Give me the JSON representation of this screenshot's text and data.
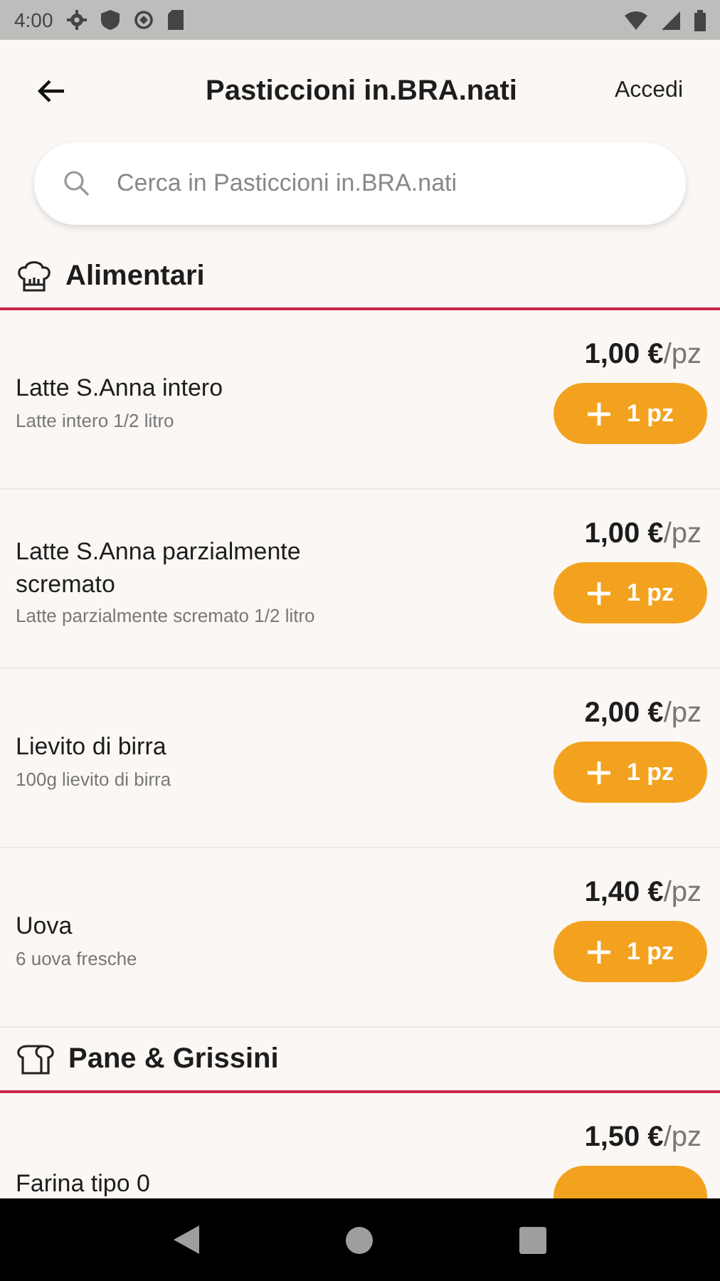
{
  "status_bar": {
    "time": "4:00"
  },
  "app_bar": {
    "title": "Pasticcioni in.BRA.nati",
    "action": "Accedi"
  },
  "search": {
    "placeholder": "Cerca in Pasticcioni in.BRA.nati"
  },
  "sections": [
    {
      "title": "Alimentari",
      "kind": "chef",
      "items": [
        {
          "name": "Latte S.Anna intero",
          "description": "Latte intero 1/2 litro",
          "price": "**1,00 €**/pz",
          "add_label": "1 pz"
        },
        {
          "name": "Latte S.Anna parzialmente scremato",
          "description": "Latte parzialmente scremato 1/2 litro",
          "price": "**1,00 €**/pz",
          "add_label": "1 pz"
        },
        {
          "name": "Lievito di birra",
          "description": "100g lievito di birra",
          "price": "**2,00 €**/pz",
          "add_label": "1 pz"
        },
        {
          "name": "Uova",
          "description": "6 uova fresche",
          "price": "**1,40 €**/pz",
          "add_label": "1 pz"
        }
      ]
    },
    {
      "title": "Pane & Grissini",
      "kind": "bread",
      "items": [
        {
          "name": "Farina tipo 0",
          "price": "**1,50 €**/pz"
        }
      ]
    }
  ]
}
